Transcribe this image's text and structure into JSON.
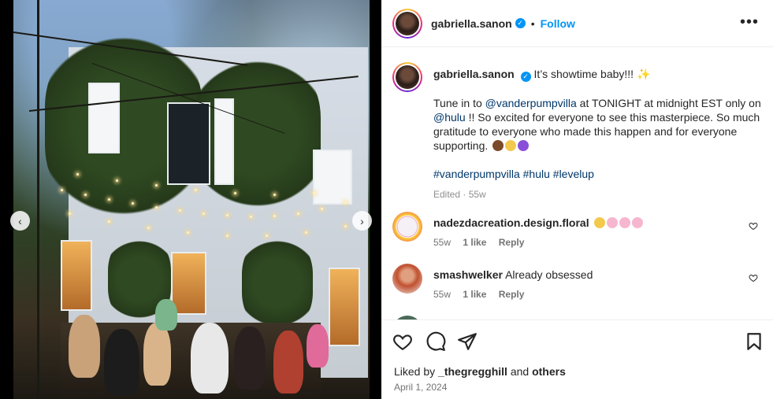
{
  "post": {
    "username": "gabriella.sanon",
    "follow_label": "Follow",
    "separator": "•",
    "more_label": "•••",
    "verified_glyph": "✓",
    "caption_title": "It’s showtime baby!!!",
    "caption_emoji": "✨",
    "caption_line_a": "Tune in to ",
    "mention_1": "@vanderpumpvilla",
    "caption_line_b": " at TONIGHT at midnight EST only on ",
    "mention_2": "@hulu",
    "caption_line_c": " !! So excited for everyone to see this masterpiece. So much gratitude to everyone who made this happen and for everyone supporting.",
    "caption_emojis": [
      "brown-heart",
      "crying-face",
      "purple-heart"
    ],
    "hashtags": [
      "#vanderpumpvilla",
      "#hulu",
      "#levelup"
    ],
    "edited": "Edited",
    "edited_time": "55w"
  },
  "comments": [
    {
      "username": "nadezdacreation.design.floral",
      "text": "",
      "emojis": [
        "smiling-hearts",
        "cherry-blossom",
        "cherry-blossom",
        "cherry-blossom"
      ],
      "time": "55w",
      "likes": "1 like",
      "reply": "Reply"
    },
    {
      "username": "smashwelker",
      "text": "Already obsessed",
      "emojis": [],
      "time": "55w",
      "likes": "1 like",
      "reply": "Reply"
    }
  ],
  "footer": {
    "liked_by_prefix": "Liked by ",
    "liked_by_user": "_thegregghill",
    "liked_by_and": " and ",
    "liked_by_others": "others",
    "date": "April 1, 2024"
  },
  "icons": {
    "like": "heart-icon",
    "comment": "comment-icon",
    "share": "share-icon",
    "save": "bookmark-icon",
    "prev": "chevron-left-icon",
    "next": "chevron-right-icon"
  },
  "colors": {
    "accent": "#0095f6",
    "link": "#00376b",
    "secondary_text": "#737373"
  }
}
